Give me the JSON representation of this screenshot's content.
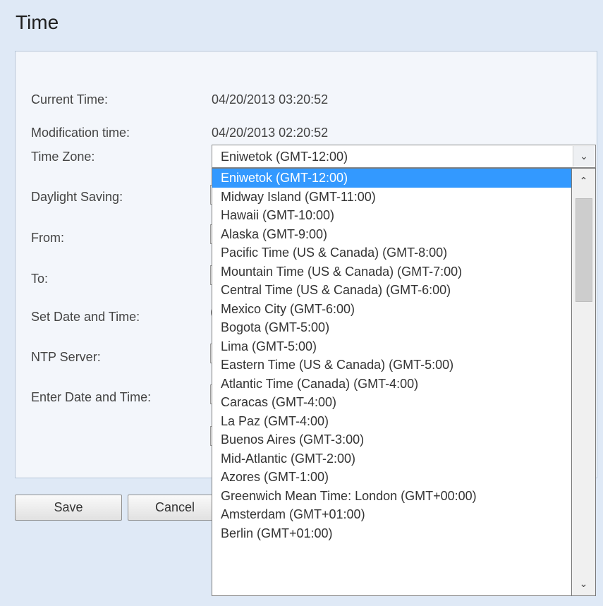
{
  "page": {
    "title": "Time"
  },
  "fields": {
    "current_time_label": "Current Time:",
    "current_time_value": "04/20/2013 03:20:52",
    "modification_time_label": "Modification time:",
    "modification_time_value": "04/20/2013 02:20:52",
    "time_zone_label": "Time Zone:",
    "time_zone_value": "Eniwetok (GMT-12:00)",
    "daylight_saving_label": "Daylight Saving:",
    "from_label": "From:",
    "to_label": "To:",
    "set_date_time_label": "Set Date and Time:",
    "ntp_server_label": "NTP Server:",
    "enter_date_time_label": "Enter Date and Time:"
  },
  "buttons": {
    "save": "Save",
    "cancel": "Cancel"
  },
  "timezone_options": [
    "Eniwetok (GMT-12:00)",
    "Midway Island (GMT-11:00)",
    "Hawaii (GMT-10:00)",
    "Alaska (GMT-9:00)",
    "Pacific Time (US & Canada) (GMT-8:00)",
    "Mountain Time (US & Canada) (GMT-7:00)",
    "Central Time (US & Canada) (GMT-6:00)",
    "Mexico City (GMT-6:00)",
    "Bogota (GMT-5:00)",
    "Lima (GMT-5:00)",
    "Eastern Time (US & Canada) (GMT-5:00)",
    "Atlantic Time (Canada) (GMT-4:00)",
    "Caracas (GMT-4:00)",
    "La Paz (GMT-4:00)",
    "Buenos Aires (GMT-3:00)",
    "Mid-Atlantic (GMT-2:00)",
    "Azores (GMT-1:00)",
    "Greenwich Mean Time: London (GMT+00:00)",
    "Amsterdam (GMT+01:00)",
    "Berlin (GMT+01:00)"
  ],
  "selected_option_index": 0,
  "icons": {
    "select_arrow": "chevron-down-icon",
    "scroll_up": "chevron-up-icon",
    "scroll_down": "chevron-down-icon"
  }
}
